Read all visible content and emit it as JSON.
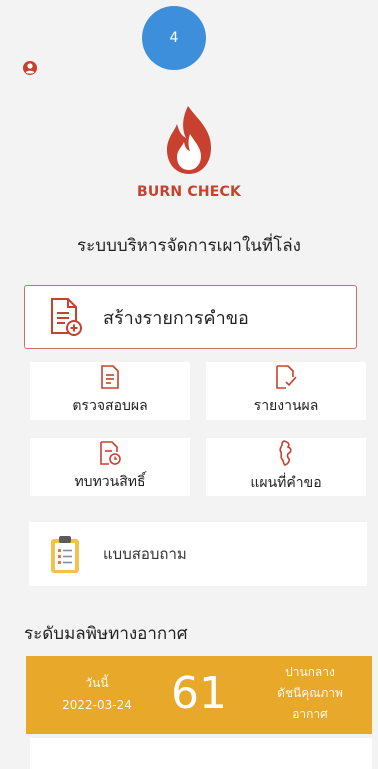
{
  "step_badge": "4",
  "app": {
    "brand": "BURN CHECK",
    "subtitle": "ระบบบริหารจัดการเผาในที่โล่ง"
  },
  "menu": {
    "create_request": "สร้างรายการคำขอ",
    "check_result": "ตรวจสอบผล",
    "report_result": "รายงานผล",
    "review_rights": "ทบทวนสิทธิ์",
    "request_map": "แผนที่คำขอ",
    "questionnaire": "แบบสอบถาม"
  },
  "air_quality": {
    "section_title": "ระดับมลพิษทางอากาศ",
    "day_label": "วันนี้",
    "date": "2022-03-24",
    "value": "61",
    "status_line1": "ปานกลาง",
    "status_line2": "ดัชนีคุณภาพ",
    "status_line3": "อากาศ",
    "panel_color": "#e8a92a"
  },
  "colors": {
    "accent_red": "#c8412f",
    "badge_blue": "#3d8fdc"
  }
}
